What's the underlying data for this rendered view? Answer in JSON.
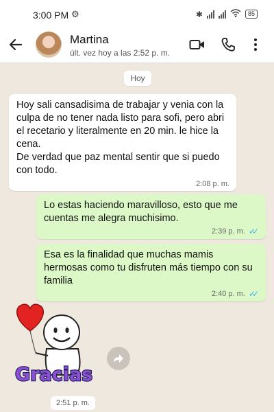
{
  "status_bar": {
    "time": "3:00 PM",
    "battery": "85"
  },
  "header": {
    "contact_name": "Martina",
    "last_seen": "últ. vez hoy a las 2:52 p. m."
  },
  "chat": {
    "day_label": "Hoy",
    "messages": [
      {
        "direction": "incoming",
        "text": "Hoy sali cansadisima de trabajar y venia con la culpa de no tener nada listo para sofi, pero abri el recetario y literalmente en 20 min. le hice la cena.\nDe verdad que paz mental sentir que si puedo con todo.",
        "time": "2:08 p. m."
      },
      {
        "direction": "outgoing",
        "text": "Lo estas haciendo maravilloso, esto que me cuentas me alegra muchisimo.",
        "time": "2:39 p. m.",
        "status": "read"
      },
      {
        "direction": "outgoing",
        "text": "Esa es la finalidad que muchas mamis hermosas como tu disfruten más tiempo con su familia",
        "time": "2:40 p. m.",
        "status": "read"
      }
    ],
    "sticker": {
      "text": "Gracias",
      "time": "2:51 p. m."
    }
  },
  "colors": {
    "outgoing_bubble": "#dcf8c6",
    "incoming_bubble": "#ffffff",
    "chat_background": "#efe8de",
    "read_ticks": "#34b7f1"
  },
  "icons": [
    "settings-gear-icon",
    "bluetooth-icon",
    "signal-icon",
    "wifi-icon",
    "battery-icon",
    "back-arrow-icon",
    "video-call-icon",
    "phone-call-icon",
    "more-options-icon",
    "forward-icon",
    "heart-balloon-icon"
  ]
}
